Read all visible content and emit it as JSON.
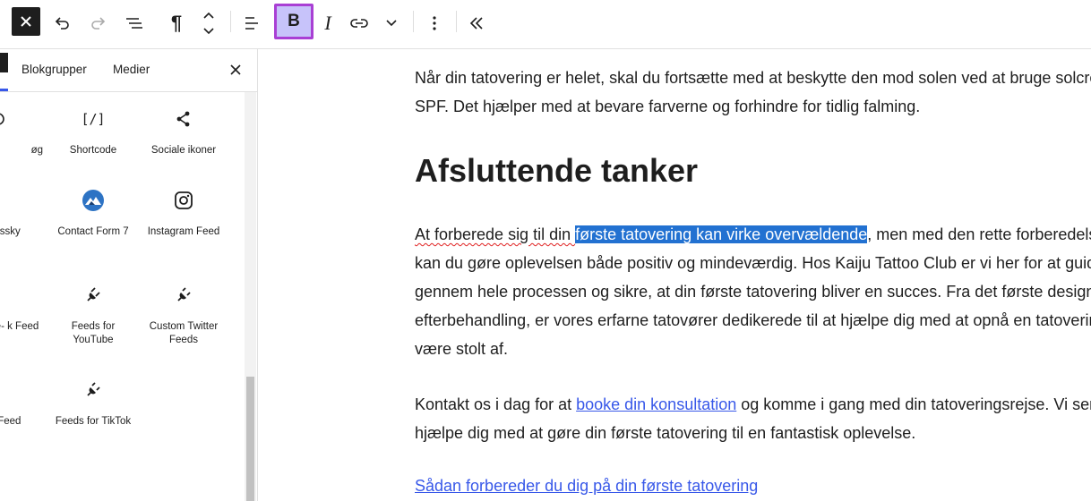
{
  "toolbar": {
    "bold_label": "B",
    "italic_label": "I",
    "paragraph_label": "¶",
    "accent_color": "#a93fd4",
    "bold_active_bg": "#c7c3fa"
  },
  "sidebar": {
    "tabs": [
      {
        "label": "Blokgrupper"
      },
      {
        "label": "Medier"
      }
    ],
    "blocks": [
      {
        "label": "øg",
        "icon": "search-icon"
      },
      {
        "label": "Shortcode",
        "icon": "shortcode-icon"
      },
      {
        "label": "Sociale ikoner",
        "icon": "share-icon"
      },
      {
        "label": "ordssky",
        "icon": "tag-icon"
      },
      {
        "label": "Contact Form 7",
        "icon": "contact-form-7-icon"
      },
      {
        "label": "Instagram Feed",
        "icon": "instagram-icon"
      },
      {
        "label": "m Face- k Feed",
        "icon": "plugin-icon"
      },
      {
        "label": "Feeds for YouTube",
        "icon": "plugin-icon"
      },
      {
        "label": "Custom Twitter Feeds",
        "icon": "plugin-icon"
      },
      {
        "label": "vs Feed",
        "icon": "plugin-icon"
      },
      {
        "label": "Feeds for TikTok",
        "icon": "plugin-icon"
      }
    ]
  },
  "editor": {
    "p1_line1": "Når din tatovering er helet, skal du fortsætte med at beskytte den mod solen ved at bruge solcreme",
    "p1_line2": "SPF. Det hjælper med at bevare farverne og forhindre for tidlig falming.",
    "heading": "Afsluttende tanker",
    "p2_line1_pre": "At forberede sig til din ",
    "p2_line1_sel": "første tatovering kan virke overvældende",
    "p2_line1_post": ", men med den rette forberedelse",
    "p2_line2": "kan du gøre oplevelsen både positiv og mindeværdig. Hos Kaiju Tattoo Club er vi her for at guide d",
    "p2_line3": "gennem hele processen og sikre, at din første tatovering bliver en succes. Fra det første designvalg",
    "p2_line4": "efterbehandling, er vores erfarne tatovører dedikerede til at hjælpe dig med at opnå en tatovering,",
    "p2_line5": "være stolt af.",
    "p3_line1_pre": "Kontakt os i dag for at ",
    "p3_line1_link": "booke din konsultation",
    "p3_line1_post": " og komme i gang med din tatoveringsrejse. Vi ser fr",
    "p3_line2": "hjælpe dig med at gøre din første tatovering til en fantastisk oplevelse.",
    "p4_link": "Sådan forbereder du dig på din første tatovering"
  }
}
